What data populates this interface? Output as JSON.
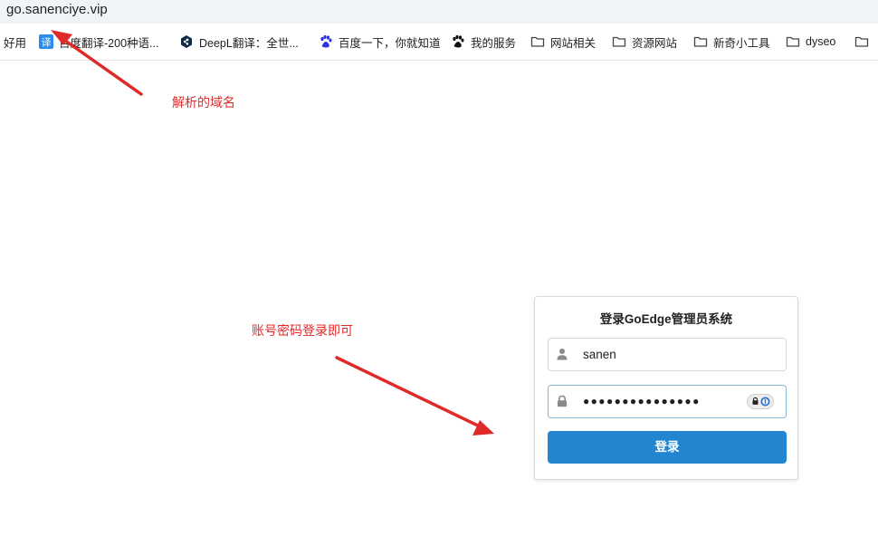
{
  "browser": {
    "address": "go.sanenciye.vip",
    "bookmarks": [
      {
        "label": "好用",
        "icon": "none"
      },
      {
        "label": "百度翻译-200种语...",
        "icon": "translate-icon"
      },
      {
        "label": "DeepL翻译：全世...",
        "icon": "deepl-icon"
      },
      {
        "label": "百度一下，你就知道",
        "icon": "baidu-paw-icon"
      },
      {
        "label": "我的服务",
        "icon": "paw-icon"
      },
      {
        "label": "网站相关",
        "icon": "folder-icon"
      },
      {
        "label": "资源网站",
        "icon": "folder-icon"
      },
      {
        "label": "新奇小工具",
        "icon": "folder-icon"
      },
      {
        "label": "dyseo",
        "icon": "folder-icon"
      }
    ],
    "translate_badge": "译"
  },
  "annotations": {
    "domain_note": "解析的域名",
    "login_note": "账号密码登录即可",
    "color": "#e02a2a"
  },
  "login": {
    "title": "登录GoEdge管理员系统",
    "username_value": "sanen",
    "password_value": "●●●●●●●●●●●●●●●",
    "submit_label": "登录",
    "accent_color": "#2185d0"
  }
}
